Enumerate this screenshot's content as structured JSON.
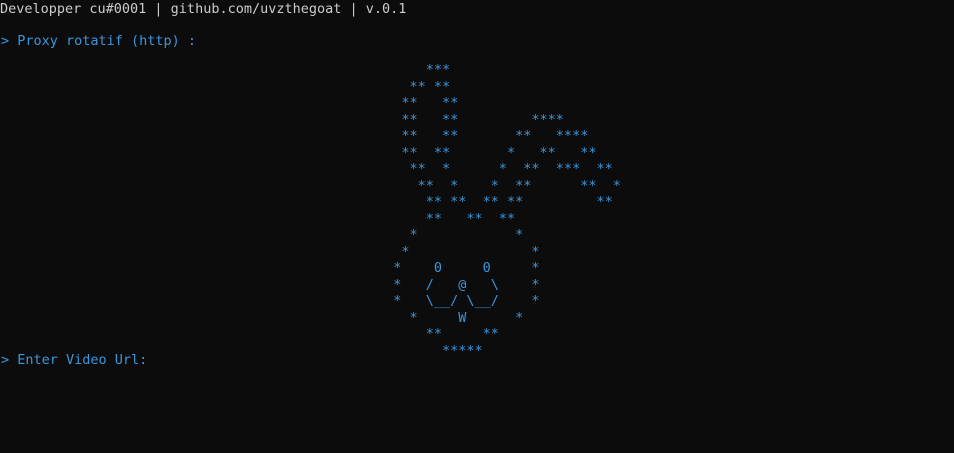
{
  "terminal": {
    "header": "Developper cu#0001 | github.com/uvzthegoat | v.0.1",
    "proxy_prompt": "> Proxy rotatif (http) :",
    "url_prompt": "> Enter Video Url:",
    "ascii_art": [
      "      ***",
      "    ** **",
      "   **   **",
      "   **   **         ****",
      "   **   **       **   ****",
      "   **  **       *   **   **",
      "    **  *      *  **  ***  **",
      "     **  *    *  **      **  *",
      "      ** **  ** **         **",
      "      **   **  **",
      "    *            *",
      "   *               *",
      "  *    0     0     *",
      "  *   /   @   \\    *",
      "  *   \\__/ \\__/    *",
      "    *     W      *",
      "      **     **",
      "        *****"
    ],
    "colors": {
      "background": "#0c0c0c",
      "text": "#cccccc",
      "accent": "#3a96dd"
    }
  }
}
